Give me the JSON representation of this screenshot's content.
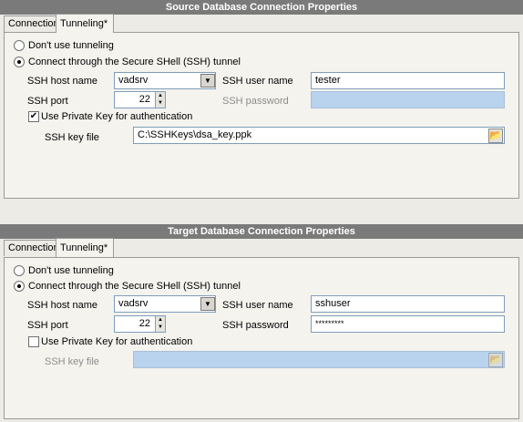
{
  "source": {
    "header": "Source Database Connection Properties",
    "tabs": [
      "Connection",
      "Tunneling*"
    ],
    "radio_no_tunnel": "Don't use tunneling",
    "radio_ssh": "Connect through the Secure SHell (SSH) tunnel",
    "host_label": "SSH host name",
    "host_value": "vadsrv",
    "user_label": "SSH user name",
    "user_value": "tester",
    "port_label": "SSH port",
    "port_value": "22",
    "password_label": "SSH password",
    "password_value": "",
    "private_key_label": "Use Private Key for authentication",
    "private_key_checked": true,
    "keyfile_label": "SSH key file",
    "keyfile_value": "C:\\SSHKeys\\dsa_key.ppk"
  },
  "target": {
    "header": "Target Database Connection Properties",
    "tabs": [
      "Connection",
      "Tunneling*"
    ],
    "radio_no_tunnel": "Don't use tunneling",
    "radio_ssh": "Connect through the Secure SHell (SSH) tunnel",
    "host_label": "SSH host name",
    "host_value": "vadsrv",
    "user_label": "SSH user name",
    "user_value": "sshuser",
    "port_label": "SSH port",
    "port_value": "22",
    "password_label": "SSH password",
    "password_value": "*********",
    "private_key_label": "Use Private Key for authentication",
    "private_key_checked": false,
    "keyfile_label": "SSH key file",
    "keyfile_value": ""
  },
  "icons": {
    "dropdown": "chevron-down-icon",
    "spin_up": "spin-up-icon",
    "spin_down": "spin-down-icon",
    "folder": "folder-open-icon",
    "checkmark": "checkmark-icon"
  }
}
